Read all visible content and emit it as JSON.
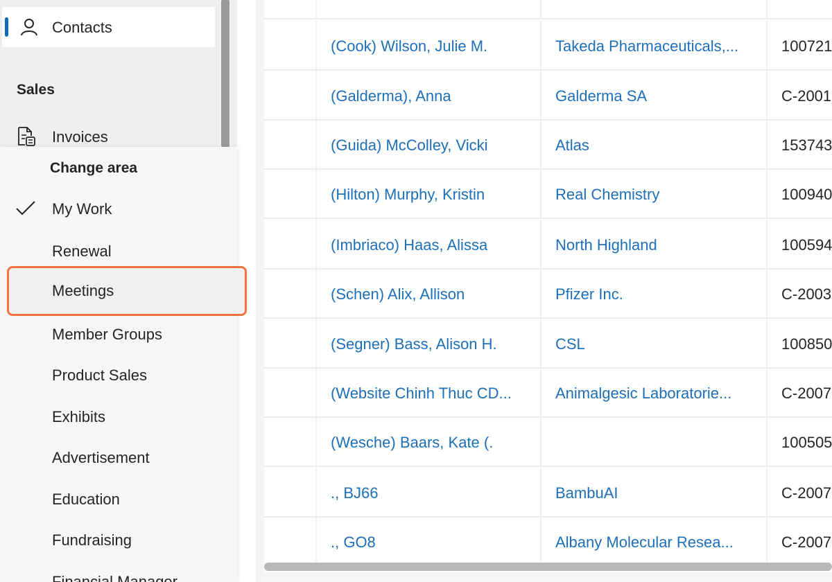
{
  "sidebar": {
    "contacts_label": "Contacts",
    "sales_heading": "Sales",
    "invoices_label": "Invoices",
    "accent_color": "#0f6cbd"
  },
  "area_menu": {
    "title": "Change area",
    "items": [
      {
        "label": "My Work",
        "selected": true
      },
      {
        "label": "Renewal"
      },
      {
        "label": "Meetings",
        "highlighted": true
      },
      {
        "label": "Member Groups"
      },
      {
        "label": "Product Sales"
      },
      {
        "label": "Exhibits"
      },
      {
        "label": "Advertisement"
      },
      {
        "label": "Education"
      },
      {
        "label": "Fundraising"
      },
      {
        "label": "Financial Manager"
      }
    ],
    "highlight_color": "#f27441"
  },
  "grid": {
    "link_color": "#1d6fb8",
    "rows": [
      {
        "name": "(Cook) Wilson, Julie M.",
        "account": "Takeda Pharmaceuticals,...",
        "id": "100721"
      },
      {
        "name": "(Galderma), Anna",
        "account": "Galderma SA",
        "id": "C-2001"
      },
      {
        "name": "(Guida) McColley, Vicki",
        "account": "Atlas",
        "id": "153743"
      },
      {
        "name": "(Hilton) Murphy, Kristin",
        "account": "Real Chemistry",
        "id": "100940"
      },
      {
        "name": "(Imbriaco) Haas, Alissa",
        "account": "North Highland",
        "id": "100594"
      },
      {
        "name": "(Schen) Alix, Allison",
        "account": "Pfizer Inc.",
        "id": "C-2003"
      },
      {
        "name": "(Segner) Bass, Alison H.",
        "account": "CSL",
        "id": "100850"
      },
      {
        "name": "(Website Chinh Thuc CD...",
        "account": "Animalgesic Laboratorie...",
        "id": "C-2007"
      },
      {
        "name": "(Wesche) Baars, Kate (.",
        "account": "",
        "id": "100505"
      },
      {
        "name": "., BJ66",
        "account": "BambuAI",
        "id": "C-2007"
      },
      {
        "name": "., GO8",
        "account": "Albany Molecular Resea...",
        "id": "C-2007"
      }
    ]
  }
}
